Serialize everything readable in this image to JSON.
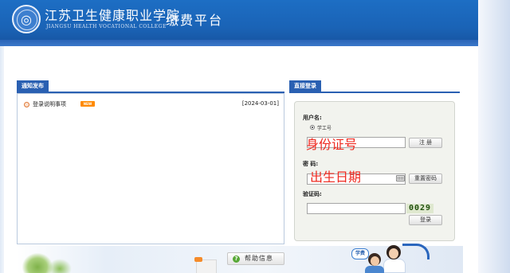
{
  "header": {
    "school_name": "江苏卫生健康职业学院",
    "school_name_en": "JIANGSU HEALTH VOCATIONAL COLLEGE",
    "platform_title": "缴费平台"
  },
  "notice_panel": {
    "tab_label": "通知发布",
    "items": [
      {
        "title": "登录说明事项",
        "badge": "NEW",
        "date": "[2024-03-01]"
      }
    ]
  },
  "login_panel": {
    "tab_label": "直接登录",
    "username_label": "用户名:",
    "username_type_option": "学工号",
    "username_overlay": "身份证号",
    "register_button": "注 册",
    "password_label": "密 码:",
    "password_overlay": "出生日期",
    "reset_password_button": "重置密码",
    "captcha_label": "验证码:",
    "captcha_code": "0029",
    "login_button": "登录"
  },
  "footer": {
    "help_button": "帮助信息",
    "speech_bubble": "学费"
  },
  "colors": {
    "header_blue": "#1a63b6",
    "tab_blue": "#2a60b2",
    "overlay_red": "#ee2a20"
  },
  "icons": {
    "logo": "college-seal-icon",
    "notice_bullet": "bullet-icon",
    "keyboard": "keyboard-icon",
    "help": "help-icon"
  }
}
